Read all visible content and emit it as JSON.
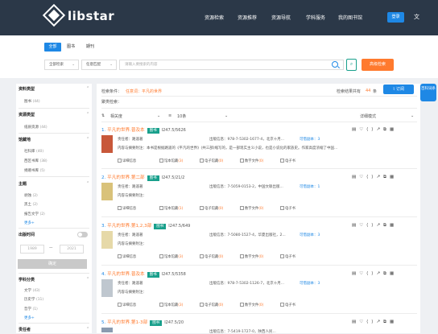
{
  "header": {
    "logo_text": "libstar",
    "nav": [
      "资源检索",
      "资源推荐",
      "资源导航",
      "学科服务",
      "我的图书馆"
    ],
    "login": "登录",
    "lang_icon": "文"
  },
  "search": {
    "tabs": [
      "全部",
      "图书",
      "期刊"
    ],
    "scope": "全部检索",
    "match": "任意匹配",
    "placeholder": "请输入要搜索的内容",
    "advanced": "高级检索"
  },
  "sidebar": {
    "res_type": {
      "title": "资料类型",
      "items": [
        {
          "label": "图书",
          "count": "(44)"
        }
      ]
    },
    "src_type": {
      "title": "资源类型",
      "items": [
        {
          "label": "纸质资源",
          "count": "(44)"
        }
      ]
    },
    "library": {
      "title": "馆藏地",
      "items": [
        {
          "label": "社科库",
          "count": "(40)"
        },
        {
          "label": "西区书库",
          "count": "(38)"
        },
        {
          "label": "捐赠书库",
          "count": "(5)"
        }
      ]
    },
    "subject": {
      "title": "主题",
      "items": [
        {
          "label": "剥蚀",
          "count": "(2)"
        },
        {
          "label": "黑土",
          "count": "(2)"
        },
        {
          "label": "报告文学",
          "count": "(2)"
        }
      ],
      "more": "更多+"
    },
    "pubyear": {
      "title": "出版时间",
      "from": "1989",
      "to": "2021",
      "confirm": "确定"
    },
    "discipline": {
      "title": "学科分类",
      "items": [
        {
          "label": "文学",
          "count": "(43)"
        },
        {
          "label": "历史学",
          "count": "(11)"
        },
        {
          "label": "哲学",
          "count": "(1)"
        }
      ],
      "more": "更多+"
    },
    "author": {
      "title": "责任者"
    }
  },
  "main": {
    "conditions_label": "检索条件：",
    "conditions_value": "任意词：平凡的世界",
    "total_prefix": "检索结果共有",
    "total_count": "44",
    "total_suffix": "条",
    "subscribe": "订阅",
    "search_within": "聚类检索：",
    "sort": "相关度",
    "pagesize": "10条",
    "view_mode": "详细模式",
    "records": [
      {
        "num": "1.",
        "title": "平凡的世界.普及本",
        "badge": "图书",
        "callno": "I247.5/5626",
        "responsible": "责任者：路遥著",
        "pubinfo": "出版信息：978-7-5302-1677-4，北京十月...",
        "avail": "可借副本：3",
        "summary": "内容与摘要附注：本书是根据路遥的《平凡的世界》(共三部)缩写的，是一部现实主义小说，也是小说化的家族史。作家高度浓缩了中国...",
        "btn_detail": "详细信息",
        "btn_holdings": "馆本馆藏",
        "holdings_count": "(3)",
        "btn_ebook": "电子馆藏",
        "ebook_count": "(0)",
        "btn_digital": "数字文件",
        "digital_count": "(0)",
        "btn_elec": "电子书"
      },
      {
        "num": "2.",
        "title": "平凡的世界.第二部",
        "badge": "图书",
        "callno": "I247.5/21/2",
        "responsible": "责任者：路遥著",
        "pubinfo": "出版信息：7-5059-0153-2，中国文联出版...",
        "avail": "可借副本：1",
        "summary": "内容与摘要附注：",
        "btn_detail": "详细信息",
        "btn_holdings": "馆本馆藏",
        "holdings_count": "(1)",
        "btn_ebook": "电子馆藏",
        "ebook_count": "(0)",
        "btn_digital": "数字文件",
        "digital_count": "(0)",
        "btn_elec": "电子书"
      },
      {
        "num": "3.",
        "title": "平凡的世界.第1,2,3部",
        "badge": "图书",
        "callno": "I247.5/649",
        "responsible": "责任者：路遥著",
        "pubinfo": "出版信息：7-5080-1527-4，华夏出版社，2...",
        "avail": "可借副本：3",
        "summary": "内容与摘要附注：",
        "btn_detail": "详细信息",
        "btn_holdings": "馆本馆藏",
        "holdings_count": "(3)",
        "btn_ebook": "电子馆藏",
        "ebook_count": "(0)",
        "btn_digital": "数字文件",
        "digital_count": "(0)",
        "btn_elec": "电子书"
      },
      {
        "num": "4.",
        "title": "平凡的世界.普及本",
        "badge": "图书",
        "callno": "I247.5/5358",
        "responsible": "责任者：路遥著",
        "pubinfo": "出版信息：978-7-5302-1126-7，北京十月...",
        "avail": "可借副本：3",
        "summary": "内容与摘要附注：",
        "btn_detail": "详细信息",
        "btn_holdings": "馆本馆藏",
        "holdings_count": "(3)",
        "btn_ebook": "电子馆藏",
        "ebook_count": "(0)",
        "btn_digital": "数字文件",
        "digital_count": "(0)",
        "btn_elec": "电子书"
      },
      {
        "num": "5.",
        "title": "平凡的世界.第1-3部",
        "badge": "图书",
        "callno": "I247.5/20",
        "responsible": "",
        "pubinfo": "出版信息：7-5419-1727-0，陕西人民...",
        "avail": "",
        "summary": "",
        "btn_detail": "",
        "btn_holdings": "",
        "holdings_count": "",
        "btn_ebook": "",
        "ebook_count": "",
        "btn_digital": "",
        "digital_count": "",
        "btn_elec": ""
      }
    ]
  },
  "right_button": "百科词条",
  "colors": {
    "header": "#2b3848",
    "accent": "#1e88e5",
    "orange": "#ff7a2e",
    "teal": "#19a08c"
  }
}
